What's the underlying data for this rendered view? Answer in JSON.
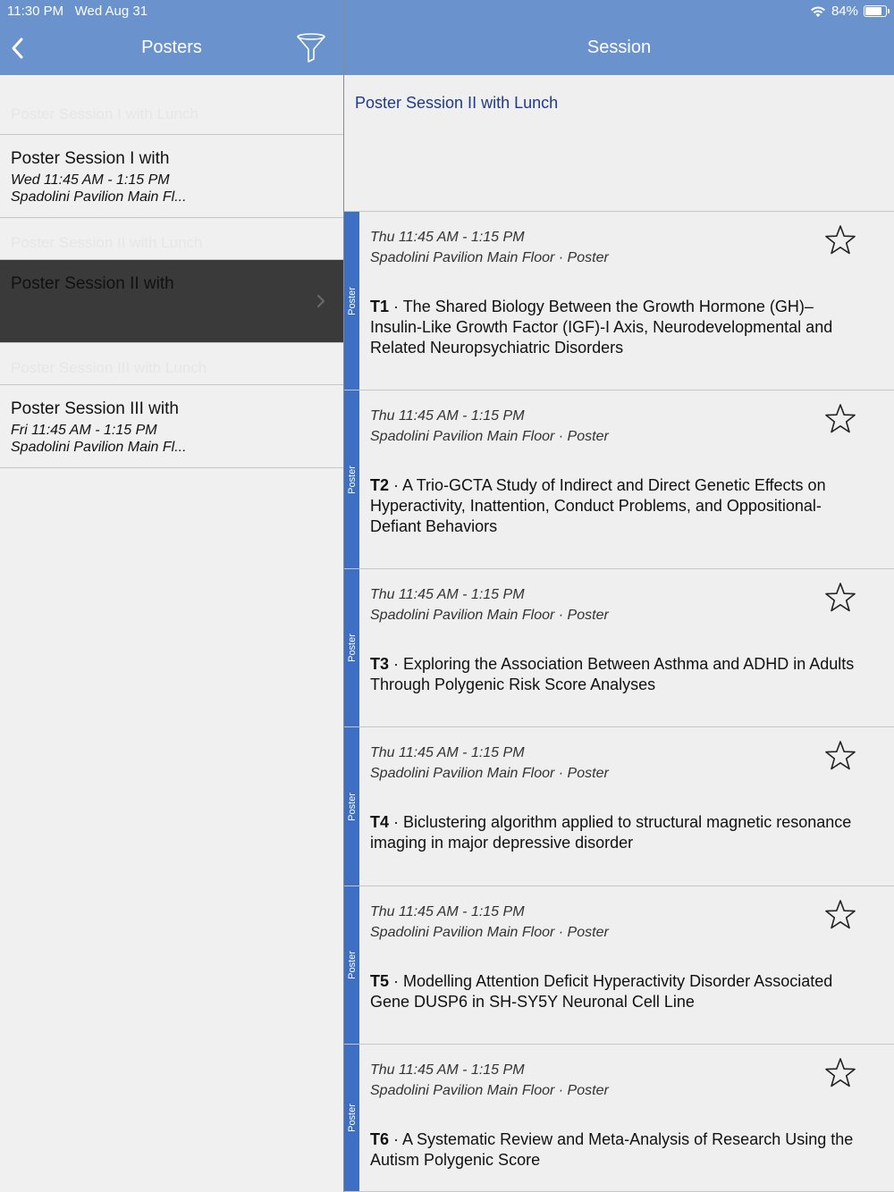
{
  "status": {
    "time": "11:30 PM",
    "date": "Wed Aug 31",
    "battery": "84%",
    "battery_level": 0.84
  },
  "left": {
    "title": "Posters",
    "faint_top": "Poster Session I with Lunch",
    "rows": [
      {
        "title": "Poster Session I with",
        "time": "Wed 11:45 AM - 1:15 PM",
        "place": "Spadolini Pavilion Main Fl..."
      },
      {
        "faint": "Poster Session II with Lunch"
      },
      {
        "title": "Poster Session II with",
        "selected": true
      },
      {
        "faint": "Poster Session III with Lunch"
      },
      {
        "title": "Poster Session III with",
        "time": "Fri 11:45 AM - 1:15 PM",
        "place": "Spadolini Pavilion Main Fl..."
      }
    ]
  },
  "right": {
    "title": "Session",
    "session_name": "Poster Session II with Lunch",
    "tag_label": "Poster",
    "cards": [
      {
        "when": "Thu 11:45 AM - 1:15 PM",
        "where": "Spadolini Pavilion Main Floor · Poster",
        "code": "T1",
        "sep": " · ",
        "text": "The Shared Biology Between the Growth Hormone (GH)–Insulin-Like Growth Factor (IGF)-I Axis, Neurodevelopmental and Related Neuropsychiatric Disorders"
      },
      {
        "when": "Thu 11:45 AM - 1:15 PM",
        "where": "Spadolini Pavilion Main Floor · Poster",
        "code": "T2",
        "sep": " · ",
        "text": "A Trio-GCTA Study of Indirect and Direct Genetic Effects on Hyperactivity, Inattention, Conduct Problems, and Oppositional-Defiant Behaviors"
      },
      {
        "when": "Thu 11:45 AM - 1:15 PM",
        "where": "Spadolini Pavilion Main Floor · Poster",
        "code": "T3",
        "sep": " · ",
        "text": "Exploring the Association Between Asthma and ADHD in Adults Through Polygenic Risk Score Analyses"
      },
      {
        "when": "Thu 11:45 AM - 1:15 PM",
        "where": "Spadolini Pavilion Main Floor · Poster",
        "code": "T4",
        "sep": " · ",
        "text": "Biclustering algorithm applied to structural magnetic resonance imaging in major depressive disorder"
      },
      {
        "when": "Thu 11:45 AM - 1:15 PM",
        "where": "Spadolini Pavilion Main Floor · Poster",
        "code": "T5",
        "sep": " · ",
        "text": "Modelling Attention Deficit Hyperactivity Disorder Associated Gene DUSP6 in SH-SY5Y Neuronal Cell Line"
      },
      {
        "when": "Thu 11:45 AM - 1:15 PM",
        "where": "Spadolini Pavilion Main Floor · Poster",
        "code": "T6",
        "sep": " · ",
        "text": "A Systematic Review and Meta-Analysis of Research Using the Autism Polygenic Score"
      }
    ]
  }
}
